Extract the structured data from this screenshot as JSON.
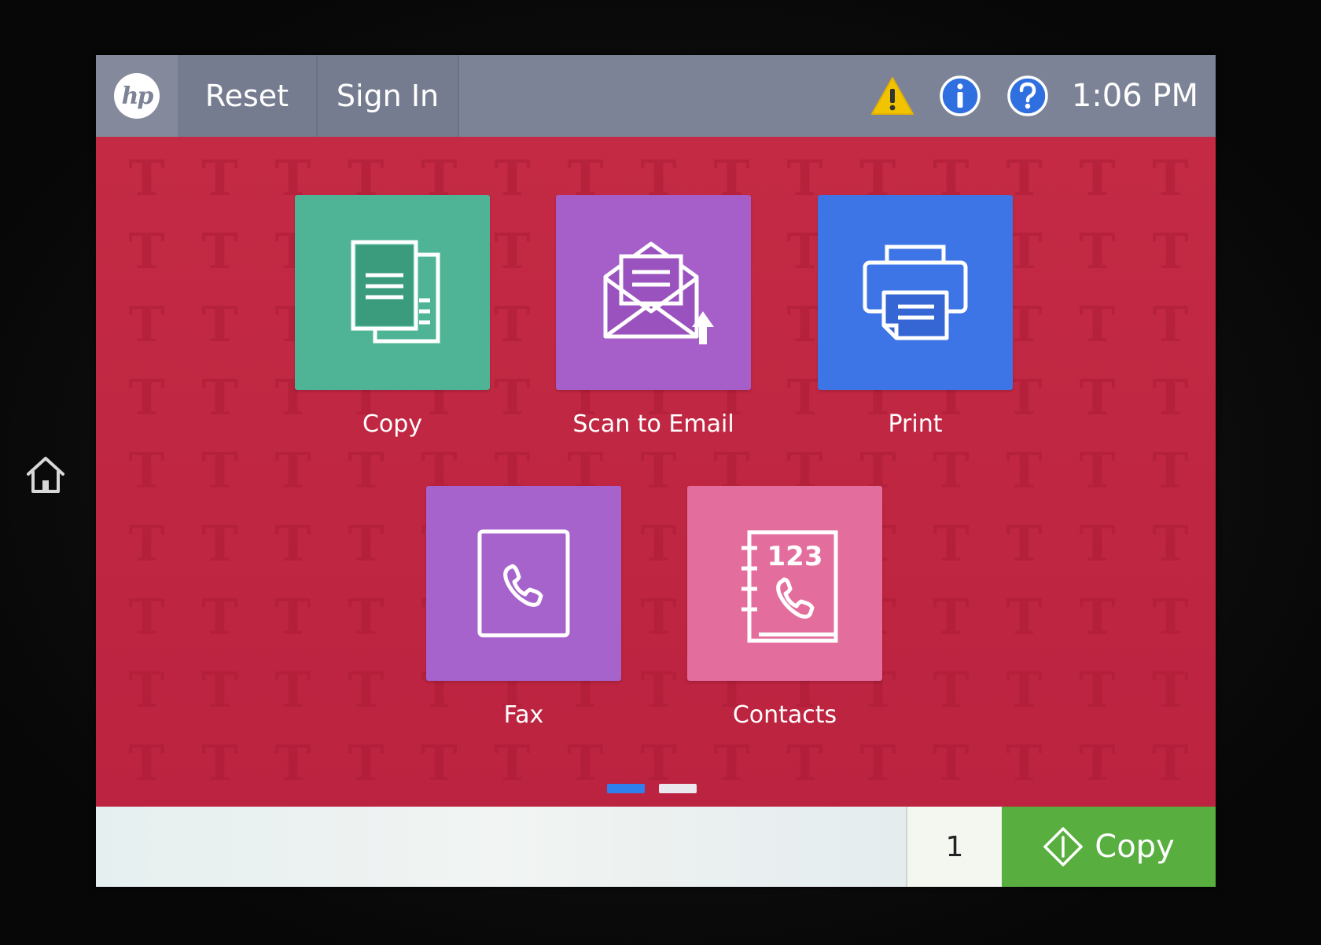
{
  "header": {
    "logo_text": "hp",
    "reset_label": "Reset",
    "sign_in_label": "Sign In",
    "time": "1:06 PM"
  },
  "status_icons": [
    "warning-icon",
    "info-icon",
    "help-icon"
  ],
  "wallpaper": {
    "pattern_glyph": "T"
  },
  "apps": [
    {
      "label": "Copy",
      "icon": "copy-icon",
      "color": "#4fb495"
    },
    {
      "label": "Scan to Email",
      "icon": "scan-to-email-icon",
      "color": "#a65fc9"
    },
    {
      "label": "Print",
      "icon": "print-icon",
      "color": "#3d74e6"
    },
    {
      "label": "Fax",
      "icon": "fax-icon",
      "color": "#a763cc"
    },
    {
      "label": "Contacts",
      "icon": "contacts-icon",
      "color": "#e36d9d",
      "icon_text": "123"
    }
  ],
  "pager": {
    "pages": 2,
    "current": 1
  },
  "footer": {
    "copies": "1",
    "start_label": "Copy",
    "start_color": "#58ae3f"
  },
  "colors": {
    "wallpaper": "#c0283f",
    "topbar": "#7d8396"
  }
}
